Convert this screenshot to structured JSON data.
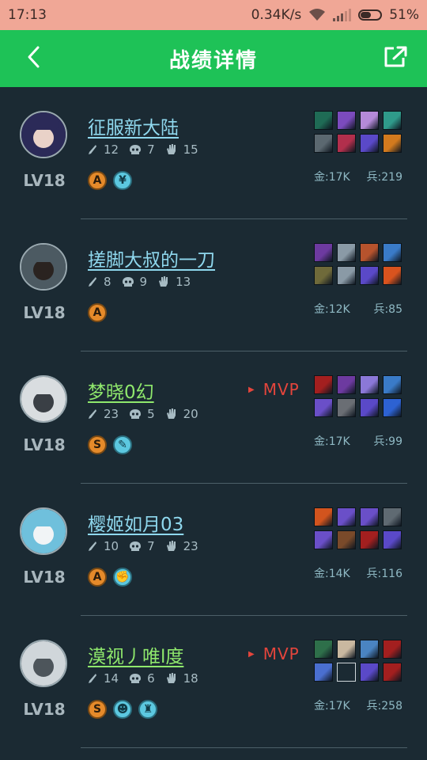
{
  "status_bar": {
    "time": "17:13",
    "network_speed": "0.34K/s",
    "battery": "51%",
    "battery_level": 0.51
  },
  "header": {
    "title": "战绩详情",
    "back_icon": "chevron-left-icon",
    "share_icon": "share-icon",
    "accent": "#1ec257"
  },
  "players": [
    {
      "name": "征服新大陆",
      "level": "LV18",
      "kills": "12",
      "deaths": "7",
      "assists": "15",
      "tags": [
        {
          "letter": "A",
          "style": "orange"
        },
        {
          "letter": "¥",
          "style": "teal"
        }
      ],
      "mvp": false,
      "gold": "金:17K",
      "soldiers": "兵:219",
      "items": [
        "#1f6b55",
        "#7b4bbd",
        "#b58ad8",
        "#2f9a8a",
        "#5b6870",
        "#b22f4c",
        "#5a49c8",
        "#d27a1e"
      ],
      "avatar": [
        "#2b2a58",
        "#e9d2c8"
      ]
    },
    {
      "name": "搓脚大叔的一刀",
      "level": "LV18",
      "kills": "8",
      "deaths": "9",
      "assists": "13",
      "tags": [
        {
          "letter": "A",
          "style": "orange"
        }
      ],
      "mvp": false,
      "gold": "金:12K",
      "soldiers": "兵:85",
      "items": [
        "#6d3aa0",
        "#8a9aa6",
        "#b7532d",
        "#3a7bc8",
        "#6f6a3a",
        "#8a9aa6",
        "#5a49c8",
        "#d9531e"
      ],
      "avatar": [
        "#4c5a62",
        "#2a2320"
      ]
    },
    {
      "name": "梦晓0幻",
      "level": "LV18",
      "kills": "23",
      "deaths": "5",
      "assists": "20",
      "tags": [
        {
          "letter": "S",
          "style": "orange"
        },
        {
          "letter": "✎",
          "style": "teal"
        }
      ],
      "mvp": true,
      "mvp_label": "MVP",
      "gold": "金:17K",
      "soldiers": "兵:99",
      "items": [
        "#a31f1f",
        "#6d3aa0",
        "#8b78d8",
        "#3a7bc8",
        "#6a4fc8",
        "#6a6e74",
        "#5a49c8",
        "#2d62d2"
      ],
      "avatar": [
        "#d9dde0",
        "#3a3f45"
      ]
    },
    {
      "name": "樱姬如月03",
      "level": "LV18",
      "kills": "10",
      "deaths": "7",
      "assists": "23",
      "tags": [
        {
          "letter": "A",
          "style": "orange"
        },
        {
          "letter": "✊",
          "style": "teal"
        }
      ],
      "mvp": false,
      "gold": "金:14K",
      "soldiers": "兵:116",
      "items": [
        "#d2541e",
        "#6a4fc8",
        "#6a4fc8",
        "#5f6a72",
        "#6a4fc8",
        "#7a4a2a",
        "#a31f1f",
        "#5a49c8"
      ],
      "avatar": [
        "#6fc0dc",
        "#f1f4f6"
      ]
    },
    {
      "name": "漠视丿唯l度",
      "level": "LV18",
      "kills": "14",
      "deaths": "6",
      "assists": "18",
      "tags": [
        {
          "letter": "S",
          "style": "orange"
        },
        {
          "letter": "☻",
          "style": "teal"
        },
        {
          "letter": "♜",
          "style": "teal"
        }
      ],
      "mvp": true,
      "mvp_label": "MVP",
      "gold": "金:17K",
      "soldiers": "兵:258",
      "items": [
        "#2e6f4a",
        "#c9b8a0",
        "#4a84c2",
        "#a31f1f",
        "#4a6fd0",
        "#1b2a33",
        "#5a49c8",
        "#a31f1f"
      ],
      "avatar": [
        "#d0d6da",
        "#4d555b"
      ]
    }
  ]
}
